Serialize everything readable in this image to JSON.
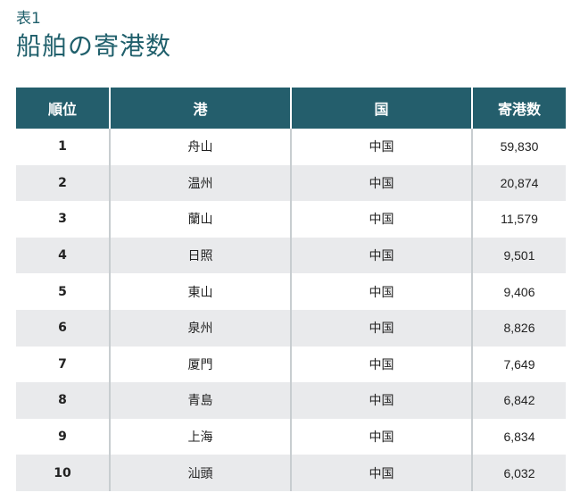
{
  "label": "表1",
  "title": "船舶の寄港数",
  "table": {
    "headers": [
      "順位",
      "港",
      "国",
      "寄港数"
    ],
    "rows": [
      {
        "rank": "1",
        "port": "舟山",
        "country": "中国",
        "count": "59,830"
      },
      {
        "rank": "2",
        "port": "温州",
        "country": "中国",
        "count": "20,874"
      },
      {
        "rank": "3",
        "port": "蘭山",
        "country": "中国",
        "count": "11,579"
      },
      {
        "rank": "4",
        "port": "日照",
        "country": "中国",
        "count": "9,501"
      },
      {
        "rank": "5",
        "port": "東山",
        "country": "中国",
        "count": "9,406"
      },
      {
        "rank": "6",
        "port": "泉州",
        "country": "中国",
        "count": "8,826"
      },
      {
        "rank": "7",
        "port": "厦門",
        "country": "中国",
        "count": "7,649"
      },
      {
        "rank": "8",
        "port": "青島",
        "country": "中国",
        "count": "6,842"
      },
      {
        "rank": "9",
        "port": "上海",
        "country": "中国",
        "count": "6,834"
      },
      {
        "rank": "10",
        "port": "汕頭",
        "country": "中国",
        "count": "6,032"
      }
    ]
  },
  "colors": {
    "header_bg": "#245e6c",
    "title_text": "#1f5f6b",
    "stripe_bg": "#e9eaec"
  }
}
